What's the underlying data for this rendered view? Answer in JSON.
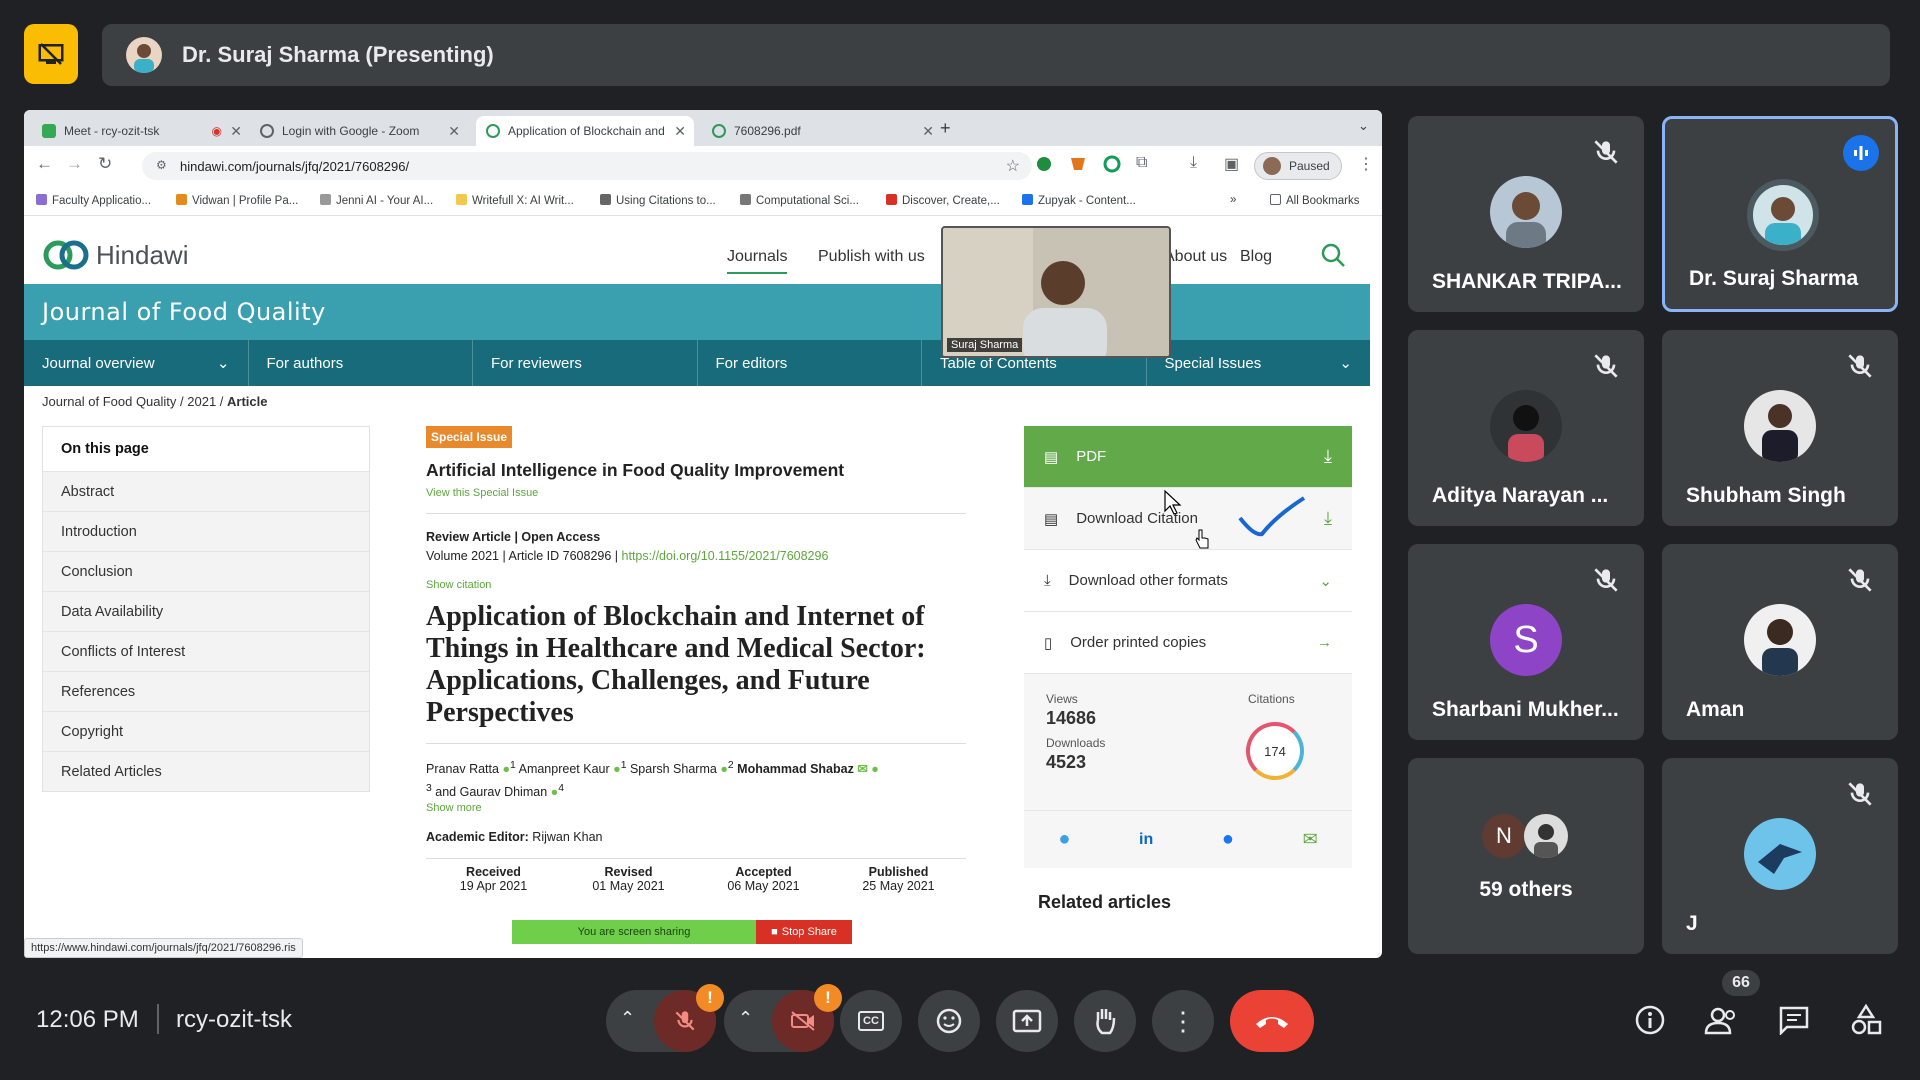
{
  "meeting": {
    "presenter_label": "Dr. Suraj Sharma (Presenting)",
    "time": "12:06 PM",
    "code": "rcy-ozit-tsk",
    "participants_count": "66"
  },
  "browser": {
    "tabs": [
      {
        "label": "Meet - rcy-ozit-tsk"
      },
      {
        "label": "Login with Google - Zoom"
      },
      {
        "label": "Application of Blockchain and"
      },
      {
        "label": "7608296.pdf"
      }
    ],
    "url": "hindawi.com/journals/jfq/2021/7608296/",
    "profile_label": "Paused",
    "bookmarks": [
      "Faculty Applicatio...",
      "Vidwan | Profile Pa...",
      "Jenni AI - Your AI...",
      "Writefull X: AI Writ...",
      "Using Citations to...",
      "Computational Sci...",
      "Discover, Create,...",
      "Zupyak - Content...",
      "All Bookmarks"
    ],
    "status_url": "https://www.hindawi.com/journals/jfq/2021/7608296.ris"
  },
  "site": {
    "logo_text": "Hindawi",
    "nav": [
      "Journals",
      "Publish with us",
      "About us",
      "Blog"
    ],
    "journal_title": "Journal of Food Quality",
    "journal_nav": [
      "Journal overview",
      "For authors",
      "For reviewers",
      "For editors",
      "Table of Contents",
      "Special Issues"
    ],
    "breadcrumb": [
      "Journal of Food Quality",
      "2021",
      "Article"
    ],
    "on_this_page": {
      "heading": "On this page",
      "items": [
        "Abstract",
        "Introduction",
        "Conclusion",
        "Data Availability",
        "Conflicts of Interest",
        "References",
        "Copyright",
        "Related Articles"
      ]
    }
  },
  "article": {
    "badge": "Special Issue",
    "special_issue_title": "Artificial Intelligence in Food Quality Improvement",
    "view_special_issue": "View this Special Issue",
    "type_line": "Review Article | Open Access",
    "volume_line": "Volume 2021 | Article ID 7608296 |",
    "doi": "https://doi.org/10.1155/2021/7608296",
    "show_citation": "Show citation",
    "title": "Application of Blockchain and Internet of Things in Healthcare and Medical Sector: Applications, Challenges, and Future Perspectives",
    "authors": [
      {
        "name": "Pranav Ratta",
        "sup": "1"
      },
      {
        "name": "Amanpreet Kaur",
        "sup": "1"
      },
      {
        "name": "Sparsh Sharma",
        "sup": "2"
      },
      {
        "name": "Mohammad Shabaz",
        "sup": "3"
      },
      {
        "name": "and Gaurav Dhiman",
        "sup": "4"
      }
    ],
    "show_more": "Show more",
    "editor_label": "Academic Editor:",
    "editor_name": "Rijwan Khan",
    "dates": [
      {
        "label": "Received",
        "value": "19 Apr 2021"
      },
      {
        "label": "Revised",
        "value": "01 May 2021"
      },
      {
        "label": "Accepted",
        "value": "06 May 2021"
      },
      {
        "label": "Published",
        "value": "25 May 2021"
      }
    ]
  },
  "sidebar": {
    "pdf": "PDF",
    "download_citation": "Download Citation",
    "other_formats": "Download other formats",
    "order_copies": "Order printed copies",
    "views_label": "Views",
    "views": "14686",
    "downloads_label": "Downloads",
    "downloads": "4523",
    "citations_label": "Citations",
    "citations": "174",
    "related_heading": "Related articles"
  },
  "self_view": {
    "name": "Suraj Sharma"
  },
  "share_banner": {
    "text": "You are screen sharing",
    "stop": "Stop Share"
  },
  "participants": [
    {
      "name": "SHANKAR TRIPA...",
      "muted": true
    },
    {
      "name": "Dr. Suraj Sharma",
      "muted": false,
      "speaking": true
    },
    {
      "name": "Aditya Narayan ...",
      "muted": true
    },
    {
      "name": "Shubham Singh",
      "muted": true
    },
    {
      "name": "Sharbani Mukher...",
      "muted": true,
      "initial": "S"
    },
    {
      "name": "Aman",
      "muted": true
    },
    {
      "name": "59 others",
      "initial": "N"
    },
    {
      "name": "J",
      "muted": true
    }
  ],
  "colors": {
    "accent_green": "#62a94a",
    "teal": "#3aa0b0",
    "dark_teal": "#176b7b",
    "end_call": "#ea4335",
    "present_yellow": "#fbbc04",
    "speaking_blue": "#8ab4f8"
  }
}
